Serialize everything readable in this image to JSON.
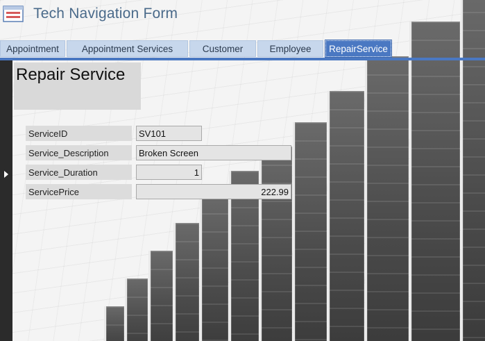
{
  "app": {
    "title": "Tech Navigation Form",
    "icon": "form-icon"
  },
  "tabs": [
    {
      "label": "Appointment",
      "active": false
    },
    {
      "label": "Appointment Services",
      "active": false
    },
    {
      "label": "Customer",
      "active": false
    },
    {
      "label": "Employee",
      "active": false
    },
    {
      "label": "RepairService",
      "active": true
    }
  ],
  "form": {
    "title": "Repair Service",
    "fields": [
      {
        "label": "ServiceID",
        "value": "SV101"
      },
      {
        "label": "Service_Description",
        "value": "Broken Screen"
      },
      {
        "label": "Service_Duration",
        "value": "1"
      },
      {
        "label": "ServicePrice",
        "value": "222.99"
      }
    ]
  },
  "colors": {
    "accent": "#4a78c2",
    "tab_bg": "#c7d7ec",
    "title_text": "#4a6a8a"
  }
}
